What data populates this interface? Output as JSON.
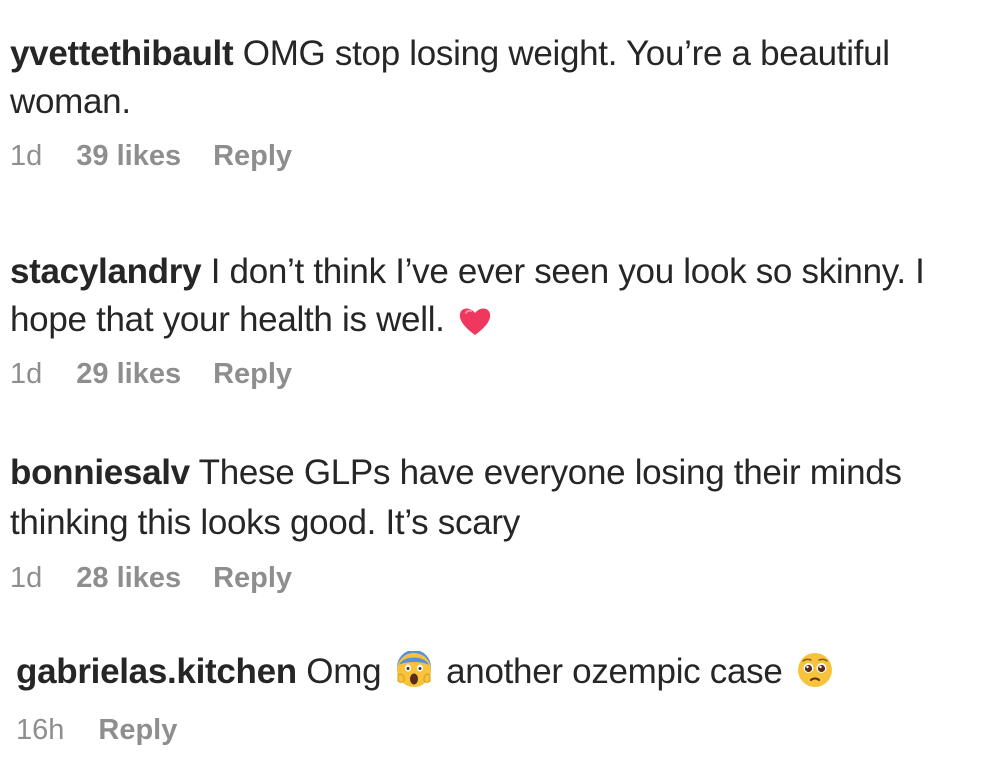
{
  "comments": [
    {
      "username": "yvettethibault",
      "text": "OMG stop losing weight. You’re a beautiful woman.",
      "time": "1d",
      "likes": "39 likes",
      "reply": "Reply"
    },
    {
      "username": "stacylandry",
      "text": "I don’t think I’ve ever seen you look so skinny. I hope that your health is well.",
      "emoji": "heart-emoji",
      "time": "1d",
      "likes": "29 likes",
      "reply": "Reply"
    },
    {
      "username": "bonniesalv",
      "text": "These GLPs have everyone losing their minds thinking this looks good. It’s scary",
      "time": "1d",
      "likes": "28 likes",
      "reply": "Reply"
    },
    {
      "username": "gabrielas.kitchen",
      "text_part1": "Omg",
      "emoji1": "screaming-face-emoji",
      "text_part2": "another ozempic case",
      "emoji2": "pleading-face-emoji",
      "time": "16h",
      "reply": "Reply"
    }
  ],
  "colors": {
    "text": "#262626",
    "meta": "#8e8e8e",
    "heart": "#f0385f",
    "emoji_yellow": "#f7c23c"
  }
}
